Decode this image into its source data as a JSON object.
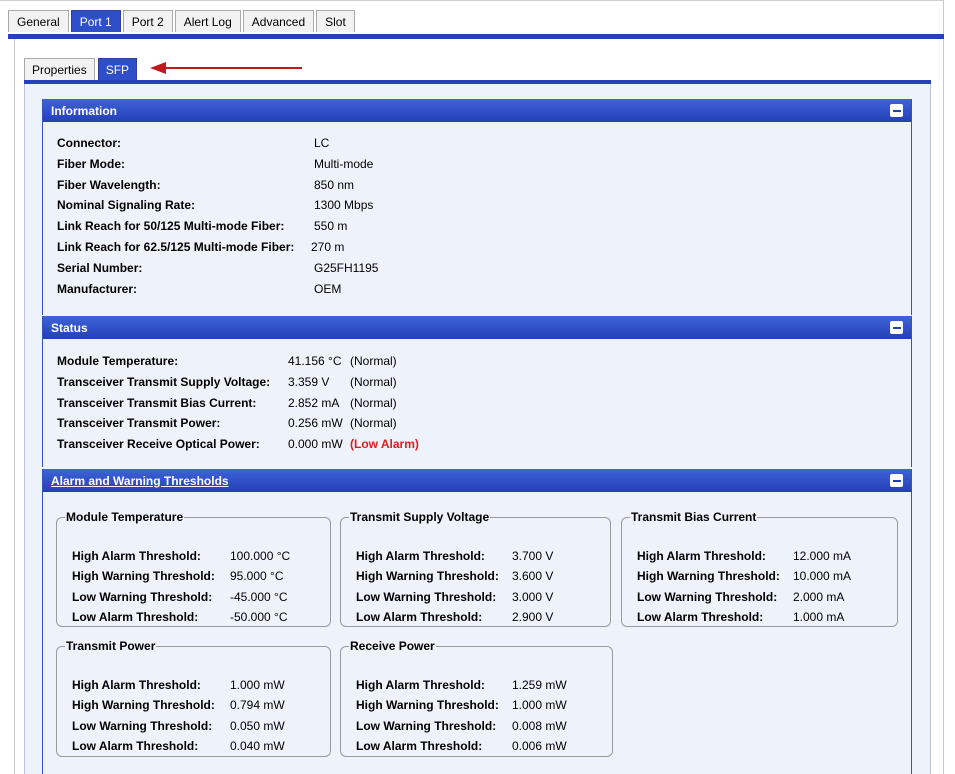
{
  "tabs": [
    {
      "label": "General",
      "active": false
    },
    {
      "label": "Port 1",
      "active": true
    },
    {
      "label": "Port 2",
      "active": false
    },
    {
      "label": "Alert Log",
      "active": false
    },
    {
      "label": "Advanced",
      "active": false
    },
    {
      "label": "Slot",
      "active": false
    }
  ],
  "subtabs": [
    {
      "label": "Properties",
      "active": false
    },
    {
      "label": "SFP",
      "active": true
    }
  ],
  "colors": {
    "accent": "#2441b8",
    "arrow": "#c0181c",
    "alarm": "#e01d1d"
  },
  "information": {
    "title": "Information",
    "rows": [
      {
        "label": "Connector:",
        "value": "LC"
      },
      {
        "label": "Fiber Mode:",
        "value": "Multi-mode"
      },
      {
        "label": "Fiber Wavelength:",
        "value": "850 nm"
      },
      {
        "label": "Nominal Signaling Rate:",
        "value": "1300 Mbps"
      },
      {
        "label": "Link Reach for 50/125 Multi-mode Fiber:",
        "value": "550 m"
      },
      {
        "label": "Link Reach for 62.5/125 Multi-mode Fiber:",
        "value": "270 m"
      },
      {
        "label": "Serial Number:",
        "value": "G25FH1195"
      },
      {
        "label": "Manufacturer:",
        "value": "OEM"
      }
    ]
  },
  "status": {
    "title": "Status",
    "rows": [
      {
        "label": "Module Temperature:",
        "value": "41.156 °C",
        "state": "(Normal)"
      },
      {
        "label": "Transceiver Transmit Supply Voltage:",
        "value": "3.359 V",
        "state": "(Normal)"
      },
      {
        "label": "Transceiver Transmit Bias Current:",
        "value": "2.852 mA",
        "state": "(Normal)"
      },
      {
        "label": "Transceiver Transmit Power:",
        "value": "0.256 mW",
        "state": "(Normal)"
      },
      {
        "label": "Transceiver Receive Optical Power:",
        "value": "0.000 mW",
        "state": "(Low Alarm)"
      }
    ]
  },
  "thresholds": {
    "title": "Alarm and Warning Thresholds",
    "groups": [
      {
        "title": "Module Temperature",
        "rows": [
          {
            "label": "High Alarm Threshold:",
            "value": "100.000 °C"
          },
          {
            "label": "High Warning Threshold:",
            "value": "95.000 °C"
          },
          {
            "label": "Low Warning Threshold:",
            "value": "-45.000 °C"
          },
          {
            "label": "Low Alarm Threshold:",
            "value": "-50.000 °C"
          }
        ]
      },
      {
        "title": "Transmit Supply Voltage",
        "rows": [
          {
            "label": "High Alarm Threshold:",
            "value": "3.700 V"
          },
          {
            "label": "High Warning Threshold:",
            "value": "3.600 V"
          },
          {
            "label": "Low Warning Threshold:",
            "value": "3.000 V"
          },
          {
            "label": "Low Alarm Threshold:",
            "value": "2.900 V"
          }
        ]
      },
      {
        "title": "Transmit Bias Current",
        "rows": [
          {
            "label": "High Alarm Threshold:",
            "value": "12.000 mA"
          },
          {
            "label": "High Warning Threshold:",
            "value": "10.000 mA"
          },
          {
            "label": "Low Warning Threshold:",
            "value": "2.000 mA"
          },
          {
            "label": "Low Alarm Threshold:",
            "value": "1.000 mA"
          }
        ]
      },
      {
        "title": "Transmit Power",
        "rows": [
          {
            "label": "High Alarm Threshold:",
            "value": "1.000 mW"
          },
          {
            "label": "High Warning Threshold:",
            "value": "0.794 mW"
          },
          {
            "label": "Low Warning Threshold:",
            "value": "0.050 mW"
          },
          {
            "label": "Low Alarm Threshold:",
            "value": "0.040 mW"
          }
        ]
      },
      {
        "title": "Receive Power",
        "rows": [
          {
            "label": "High Alarm Threshold:",
            "value": "1.259 mW"
          },
          {
            "label": "High Warning Threshold:",
            "value": "1.000 mW"
          },
          {
            "label": "Low Warning Threshold:",
            "value": "0.008 mW"
          },
          {
            "label": "Low Alarm Threshold:",
            "value": "0.006 mW"
          }
        ]
      }
    ]
  }
}
